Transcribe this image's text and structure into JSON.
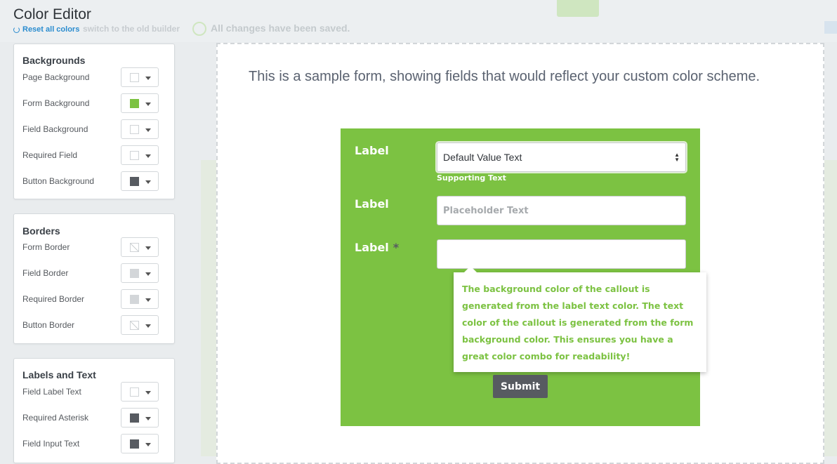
{
  "editor": {
    "title": "Color Editor",
    "reset_label": "Reset all colors"
  },
  "background_app": {
    "note": "switch to the old builder",
    "saved": "All changes have been saved."
  },
  "panels": {
    "backgrounds": {
      "title": "Backgrounds",
      "rows": [
        {
          "label": "Page Background",
          "swatch": "#ffffff"
        },
        {
          "label": "Form Background",
          "swatch": "#7cc242"
        },
        {
          "label": "Field Background",
          "swatch": "#ffffff"
        },
        {
          "label": "Required Field",
          "swatch": "#ffffff"
        },
        {
          "label": "Button Background",
          "swatch": "#575b61"
        }
      ]
    },
    "borders": {
      "title": "Borders",
      "rows": [
        {
          "label": "Form Border",
          "swatch": "none"
        },
        {
          "label": "Field Border",
          "swatch": "#d3d6d9"
        },
        {
          "label": "Required Border",
          "swatch": "#d3d6d9"
        },
        {
          "label": "Button Border",
          "swatch": "none"
        }
      ]
    },
    "labels_text": {
      "title": "Labels and Text",
      "rows": [
        {
          "label": "Field Label Text",
          "swatch": "#ffffff"
        },
        {
          "label": "Required Asterisk",
          "swatch": "#575b61"
        },
        {
          "label": "Field Input Text",
          "swatch": "#575b61"
        }
      ]
    }
  },
  "preview": {
    "intro": "This is a sample form, showing fields that would reflect your custom color scheme.",
    "form": {
      "label_1": "Label",
      "select_value": "Default Value Text",
      "supporting_text": "Supporting Text",
      "label_2": "Label",
      "placeholder": "Placeholder Text",
      "label_3": "Label",
      "asterisk": "*",
      "callout": "The background color of the callout is generated from the label text color. The text color of the callout is generated from the form background color. This ensures you have a great color combo for readability!",
      "submit_label": "Submit"
    }
  },
  "colors": {
    "form_background": "#7cc242",
    "button_background": "#575b61",
    "accent_link": "#2a8ccf"
  }
}
